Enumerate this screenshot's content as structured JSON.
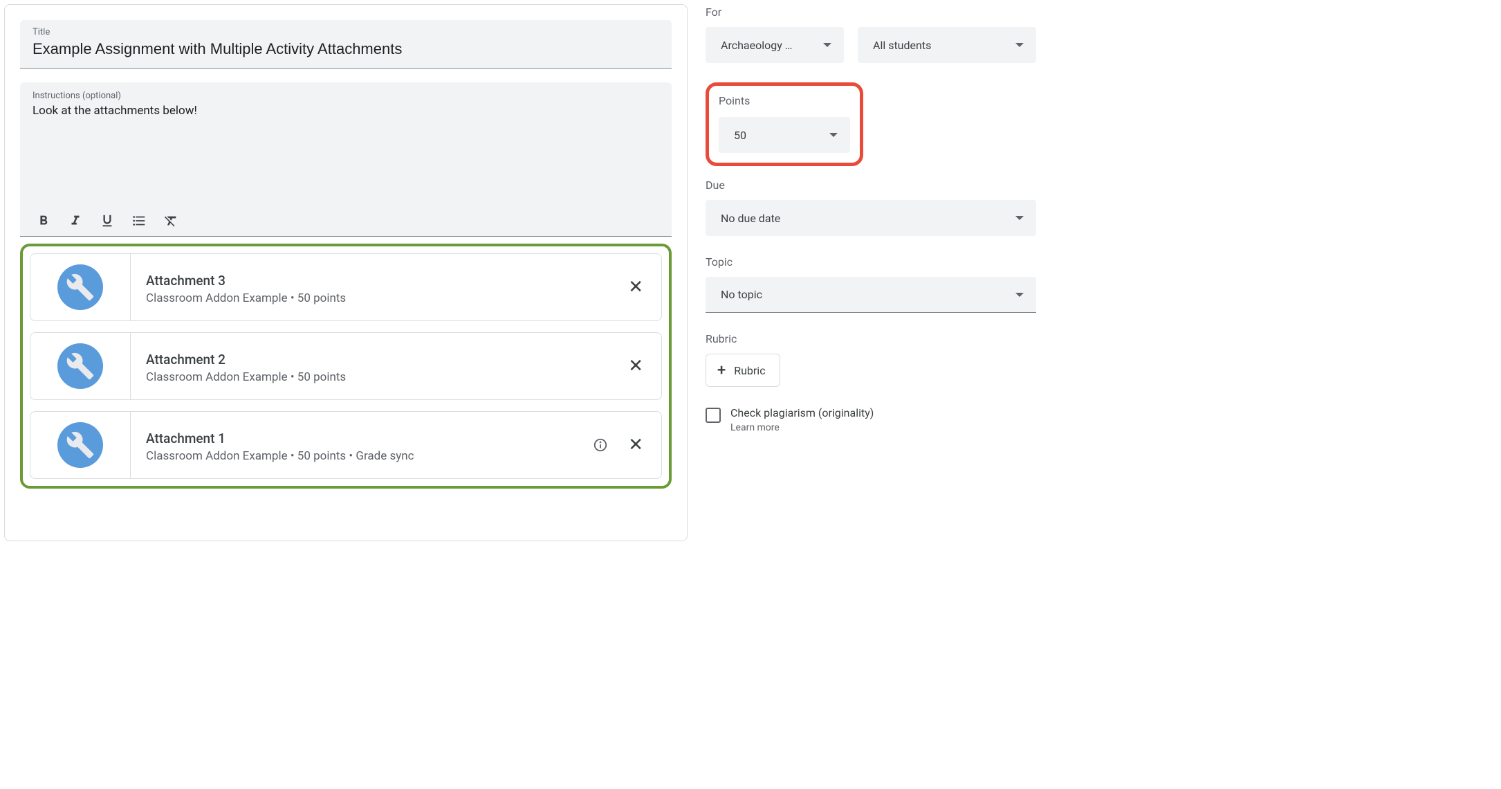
{
  "assignment": {
    "title_label": "Title",
    "title_value": "Example Assignment with Multiple Activity Attachments",
    "instructions_label": "Instructions (optional)",
    "instructions_value": "Look at the attachments below!"
  },
  "attachments": [
    {
      "title": "Attachment 3",
      "subtitle": "Classroom Addon Example • 50 points",
      "has_info": false
    },
    {
      "title": "Attachment 2",
      "subtitle": "Classroom Addon Example • 50 points",
      "has_info": false
    },
    {
      "title": "Attachment 1",
      "subtitle": "Classroom Addon Example • 50 points • Grade sync",
      "has_info": true
    }
  ],
  "sidebar": {
    "for_label": "For",
    "class_select": "Archaeology …",
    "students_select": "All students",
    "points_label": "Points",
    "points_value": "50",
    "due_label": "Due",
    "due_value": "No due date",
    "topic_label": "Topic",
    "topic_value": "No topic",
    "rubric_label": "Rubric",
    "rubric_button": "Rubric",
    "plagiarism_label": "Check plagiarism (originality)",
    "learn_more": "Learn more"
  }
}
